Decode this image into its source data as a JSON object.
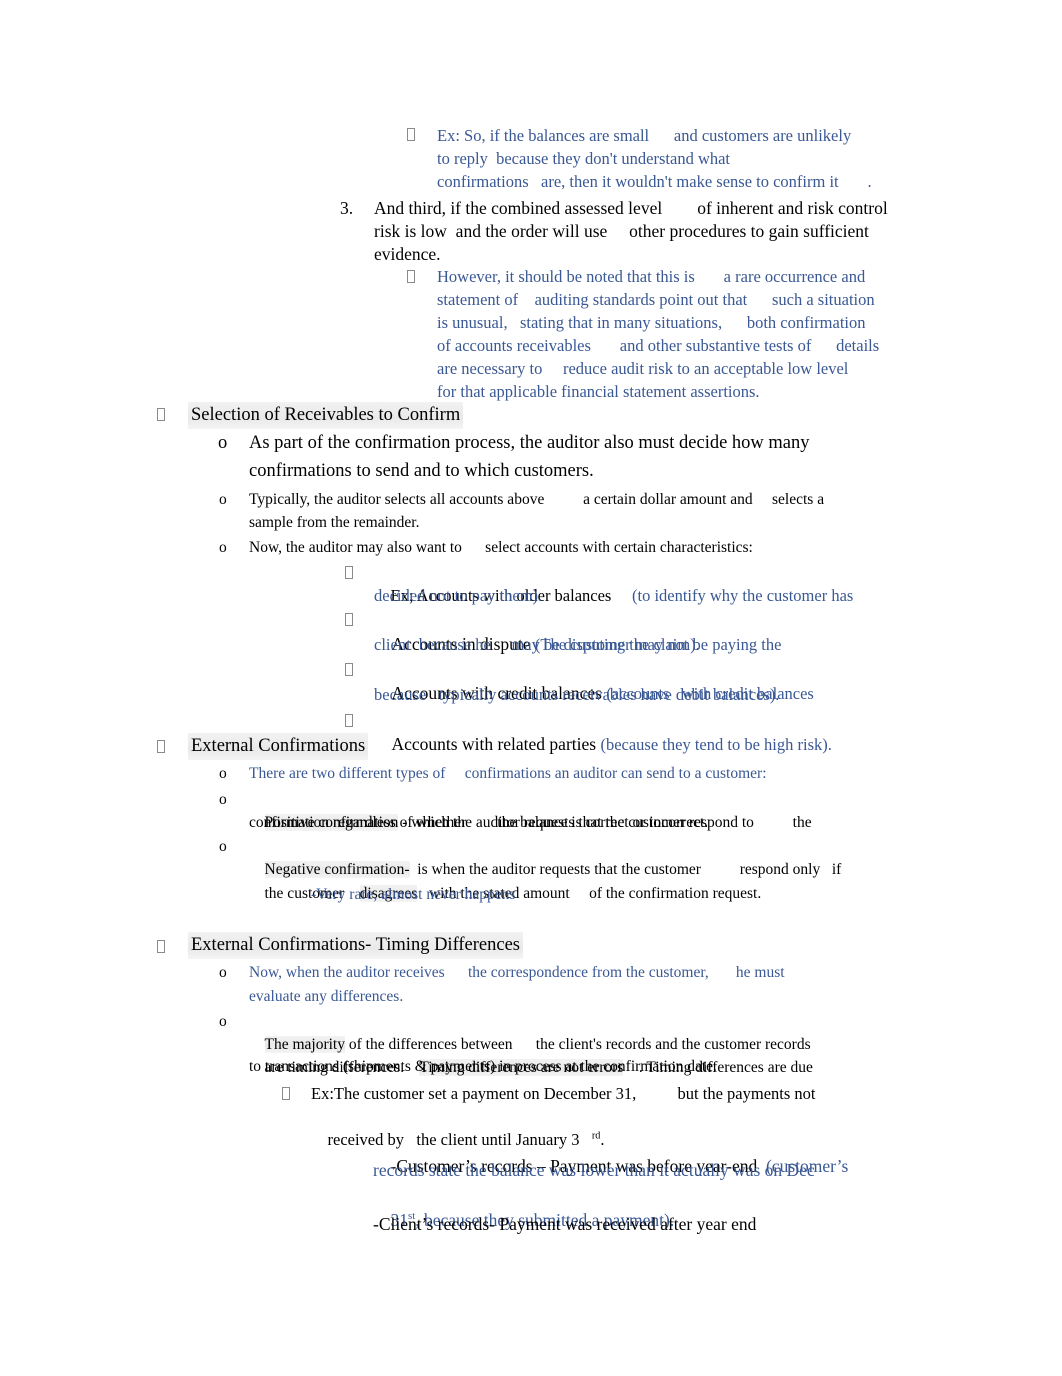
{
  "document": {
    "type": "lecture-notes",
    "title_visible": false,
    "colors": {
      "body_text": "#000000",
      "annotation_text": "#3A5894",
      "highlight": "#eeeeee"
    },
    "bullet_glyph": "missing-glyph-box"
  },
  "content": {
    "ex_balances": {
      "l1": "Ex: So, if the balances are small      and customers are unlikely",
      "l2": "to reply  because they don't understand what",
      "l3": "confirmations   are, then it wouldn't make sense to confirm it       ."
    },
    "item3": {
      "number": "3.",
      "l1": "And third, if the combined assessed level        of inherent and risk control",
      "l2": "risk is low  and the order will use     other procedures to gain sufficient",
      "l3": "evidence."
    },
    "however": {
      "l1": "However, it should be noted that this is       a rare occurrence and",
      "l2": "statement of    auditing standards point out that      such a situation",
      "l3": "is unusual,   stating that in many situations,      both confirmation",
      "l4": "of accounts receivables       and other substantive tests of      details",
      "l5": "are necessary to     reduce audit risk to an acceptable low level",
      "l6": "for that applicable financial statement assertions."
    },
    "selection_heading": "Selection of Receivables to Confirm",
    "selection": {
      "b1_l1": "As part of the confirmation process, the auditor also must decide how many",
      "b1_l2": "confirmations to send and to which customers.",
      "b2_l1": "Typically, the auditor selects all accounts above          a certain dollar amount and     selects a",
      "b2_l2": "sample from the remainder.",
      "b3_l1": "Now, the auditor may also want to      select accounts with certain characteristics:"
    },
    "characteristics": {
      "older_balances_black": "Ex; Accounts with older balances",
      "older_balances_blue_l1": "(to identify why the customer has",
      "older_balances_blue_l2": "decided not to pay them).",
      "dispute_black": "Accounts in dispute",
      "dispute_blue_l1": "(The customer may not be paying the",
      "dispute_blue_l2": "client  because he     may be disputing the claim).",
      "credit_black": "Accounts with credit balances",
      "credit_blue_l1": "(accounts   with credit balances",
      "credit_blue_l2": "because   typically accounts receivables have debit balances).",
      "related_black": "Accounts with related parties",
      "related_blue": "(because they tend to be high risk)."
    },
    "external_confirmations_heading": "External Confirmations",
    "external": {
      "b1": "There are two different types of     confirmations an auditor can send to a customer:",
      "b2_hl": "Positive confirmation",
      "b2_l1_rest": " - which the auditor requests that the customer respond to          the",
      "b2_l2": "confirmation regardless of whether        the balance is correct or incorrect.",
      "b3_hl": "Negative confirmation-",
      "b3_l1_rest": "  is when the auditor requests that the customer          respond only   if",
      "b3_l2_a": "the customer    ",
      "b3_l2_hl": "disagrees",
      "b3_l2_b": "   with the stated amount     of the confirmation request.",
      "b3_note": "-Very rare, almost never happens"
    },
    "timing_heading": "External Confirmations- Timing Differences",
    "timing": {
      "b1_l1": "Now, when the auditor receives      the correspondence from the customer,       he must",
      "b1_l2": "evaluate any differences.",
      "b2_l1_a": "The majority",
      "b2_l1_b": " of the differences between      the client's records and the customer records",
      "b2_l2_a": "are timing differences.    ",
      "b2_l2_hl": "Timing differences are not errors",
      "b2_l2_b": "    . Timing differences are due",
      "b2_l3": "to transactions (shipments & payments) in process at the confirmation date.",
      "ex_l1": "Ex:The customer set a payment on December 31,          but the payments not",
      "ex_l2_a": "received by   the client until January 3   ",
      "ex_l2_sup": "rd",
      "ex_l2_b": ".",
      "cust_black": "-Customer’s records – Payment was before year-end",
      "cust_blue_l1": "(customer’s",
      "cust_blue_l2": "records state the balance was lower than it actually was on Dec",
      "cust_blue_l3_a": "31",
      "cust_blue_l3_sup": "st",
      "cust_blue_l3_b": ", because they submitted a payment).",
      "client_black": "-Client’s records- Payment was received after year end"
    }
  }
}
